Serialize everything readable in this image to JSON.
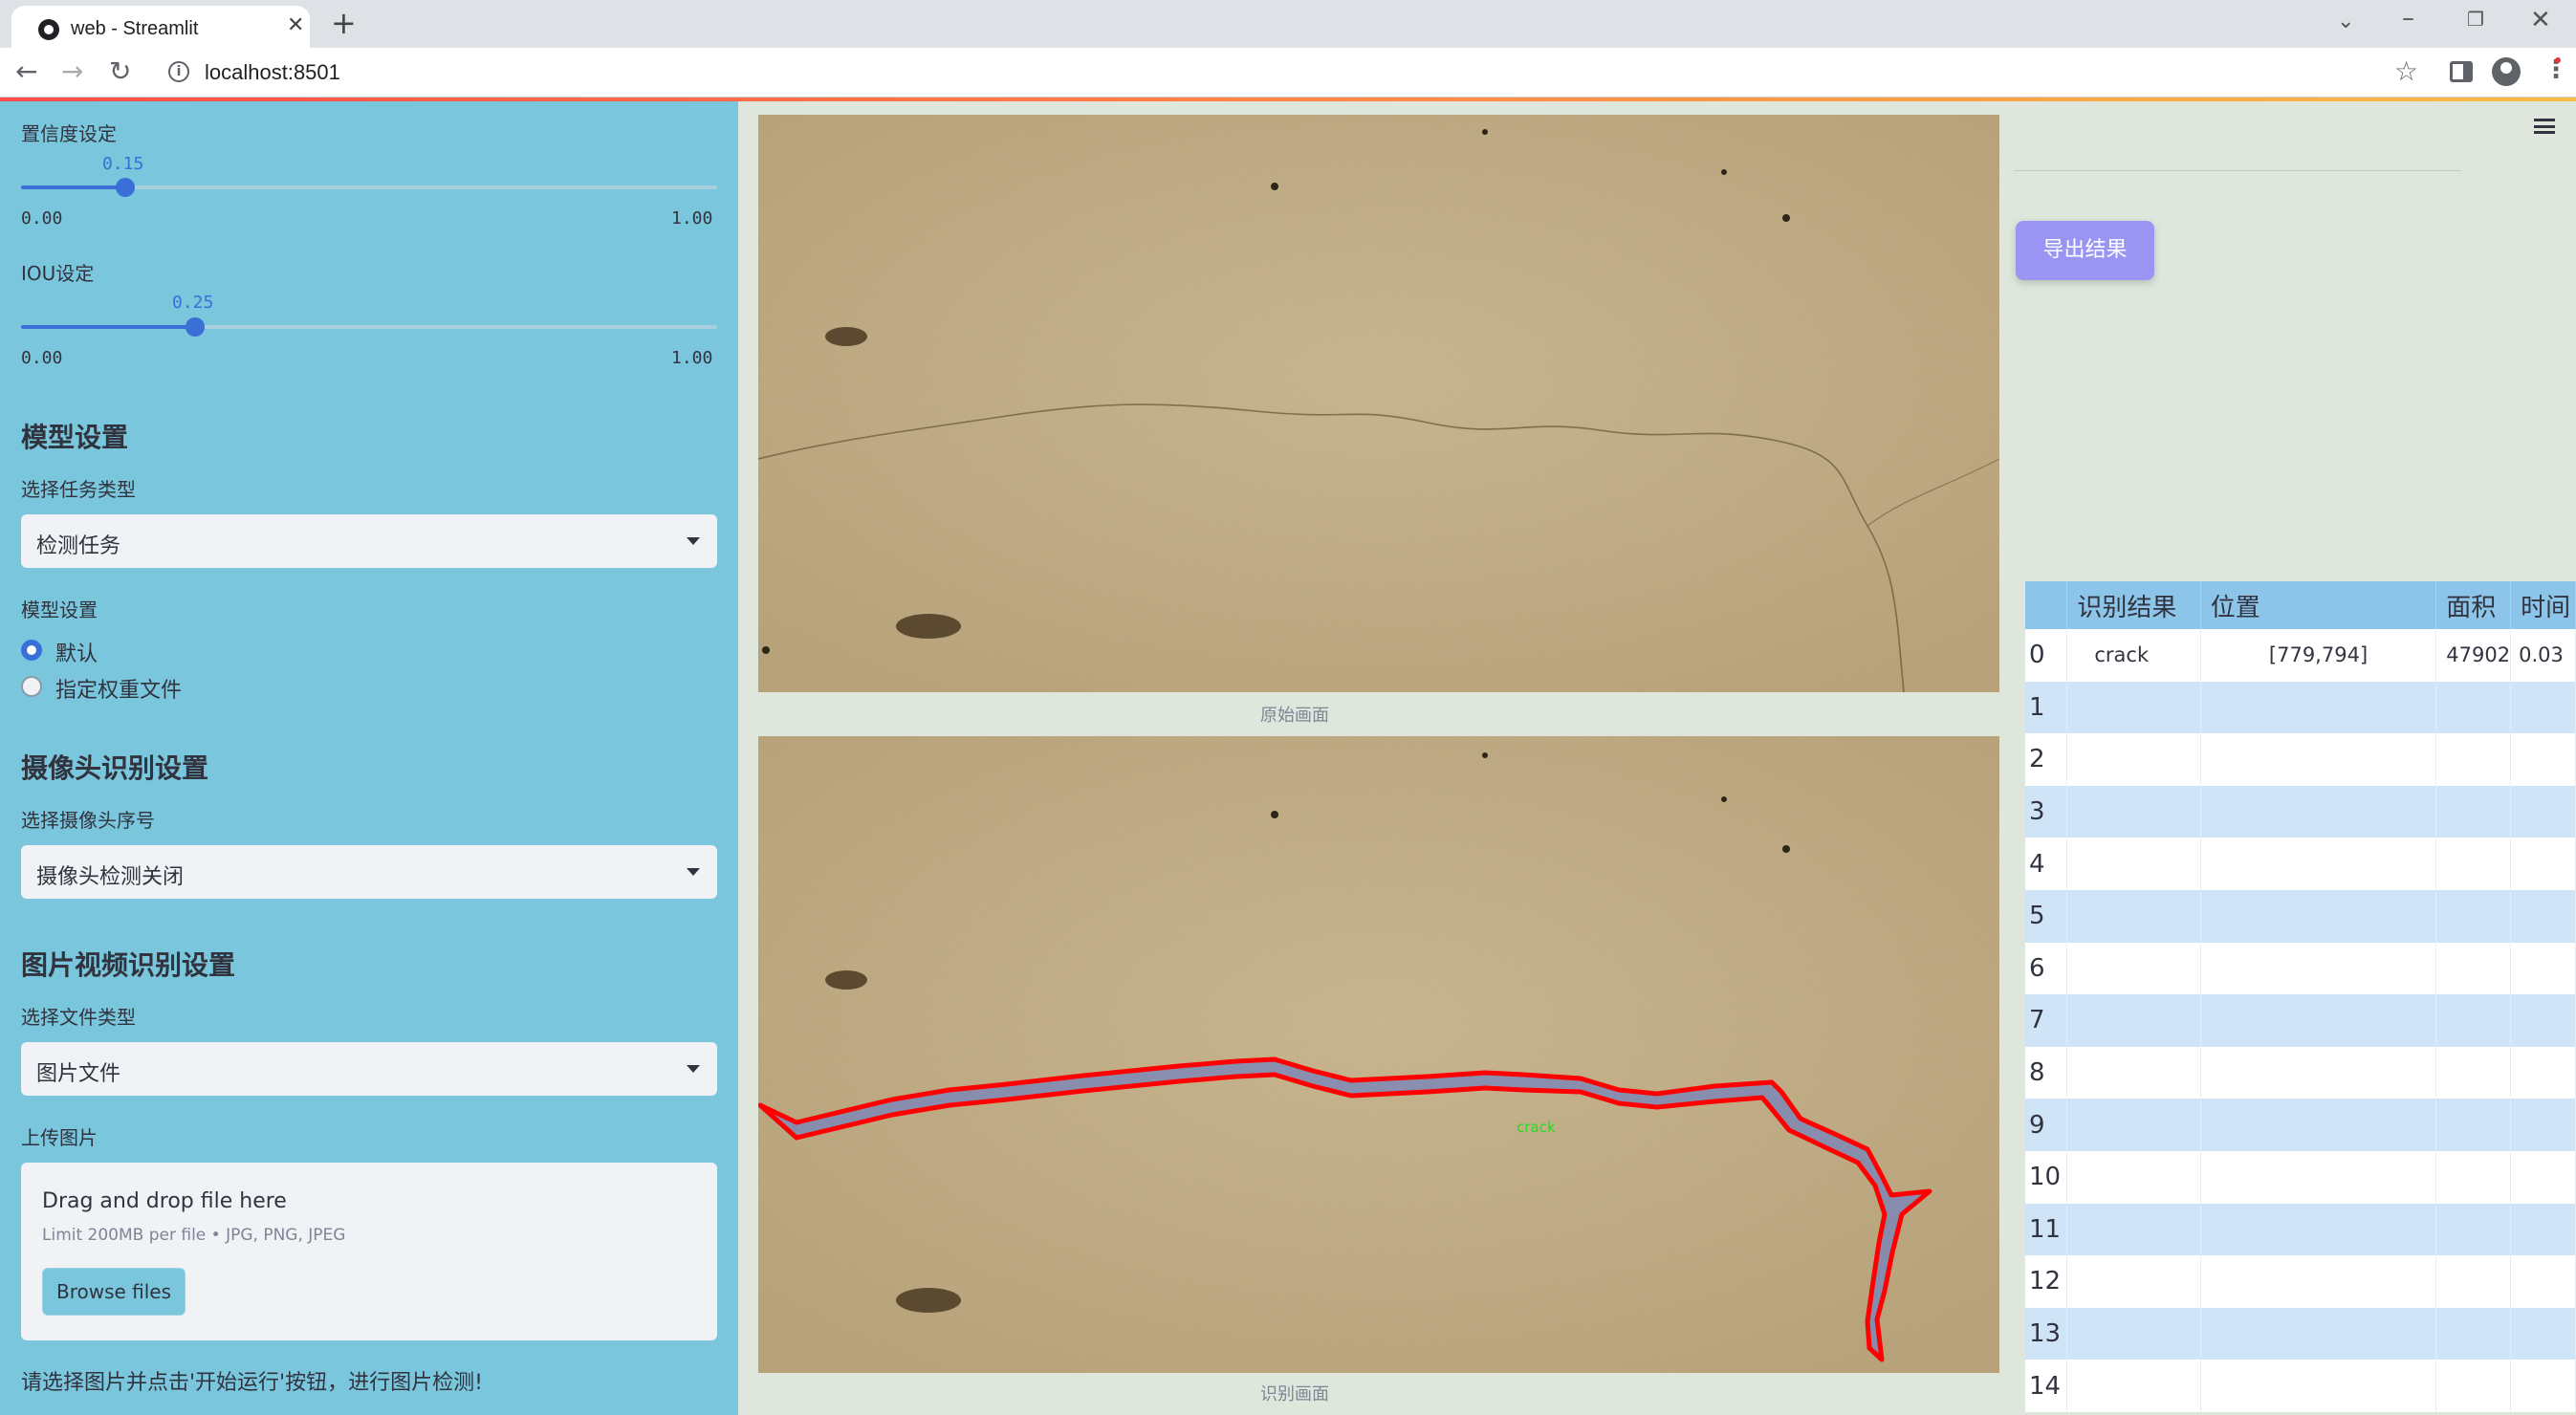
{
  "browser": {
    "tab_title": "web - Streamlit",
    "url": "localhost:8501"
  },
  "sidebar": {
    "confidence_label": "置信度设定",
    "confidence_value": "0.15",
    "confidence_level": 0.15,
    "confidence_min": "0.00",
    "confidence_max": "1.00",
    "iou_label": "IOU设定",
    "iou_value": "0.25",
    "iou_level": 0.25,
    "iou_min": "0.00",
    "iou_max": "1.00",
    "model_heading": "模型设置",
    "task_type_label": "选择任务类型",
    "task_type_value": "检测任务",
    "model_label": "模型设置",
    "model_options": [
      "默认",
      "指定权重文件"
    ],
    "camera_heading": "摄像头识别设置",
    "camera_label": "选择摄像头序号",
    "camera_value": "摄像头检测关闭",
    "media_heading": "图片视频识别设置",
    "file_type_label": "选择文件类型",
    "file_type_value": "图片文件",
    "upload_label": "上传图片",
    "upload_title": "Drag and drop file here",
    "upload_limit": "Limit 200MB per file • JPG, PNG, JPEG",
    "browse_label": "Browse files",
    "footer_text": "请选择图片并点击'开始运行'按钮，进行图片检测!"
  },
  "main": {
    "original_caption": "原始画面",
    "result_caption": "识别画面",
    "detection_label": "crack",
    "export_label": "导出结果"
  },
  "table": {
    "columns": [
      "",
      "识别结果",
      "位置",
      "面积",
      "时间"
    ],
    "rows": [
      [
        "0",
        "crack",
        "[779,794]",
        "47902",
        "0.03"
      ],
      [
        "1",
        "",
        "",
        "",
        ""
      ],
      [
        "2",
        "",
        "",
        "",
        ""
      ],
      [
        "3",
        "",
        "",
        "",
        ""
      ],
      [
        "4",
        "",
        "",
        "",
        ""
      ],
      [
        "5",
        "",
        "",
        "",
        ""
      ],
      [
        "6",
        "",
        "",
        "",
        ""
      ],
      [
        "7",
        "",
        "",
        "",
        ""
      ],
      [
        "8",
        "",
        "",
        "",
        ""
      ],
      [
        "9",
        "",
        "",
        "",
        ""
      ],
      [
        "10",
        "",
        "",
        "",
        ""
      ],
      [
        "11",
        "",
        "",
        "",
        ""
      ],
      [
        "12",
        "",
        "",
        "",
        ""
      ],
      [
        "13",
        "",
        "",
        "",
        ""
      ],
      [
        "14",
        "",
        "",
        "",
        ""
      ]
    ]
  },
  "colors": {
    "sidebar_bg": "#7ac6dc",
    "main_bg": "#dfe7dc",
    "accent": "#3a6fd8",
    "export_button": "#9a94f2",
    "detection_outline": "#ff0000",
    "detection_fill": "#7b86b8",
    "detection_label": "#22dd22"
  }
}
